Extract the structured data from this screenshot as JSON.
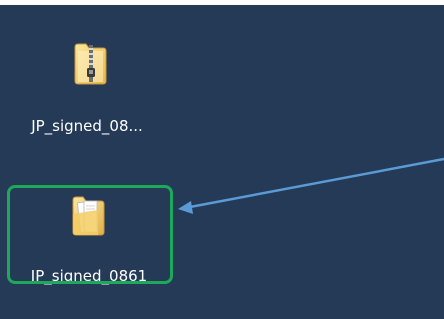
{
  "desktop": {
    "icons": [
      {
        "label": "JP_signed_08...",
        "icon": "zip-folder-icon"
      },
      {
        "label": "JP_signed_0861",
        "icon": "folder-icon"
      }
    ]
  },
  "annotation": {
    "highlight_color": "#1ea85a",
    "arrow_color": "#5b9bd5"
  },
  "colors": {
    "desktop_background": "#243a56"
  }
}
